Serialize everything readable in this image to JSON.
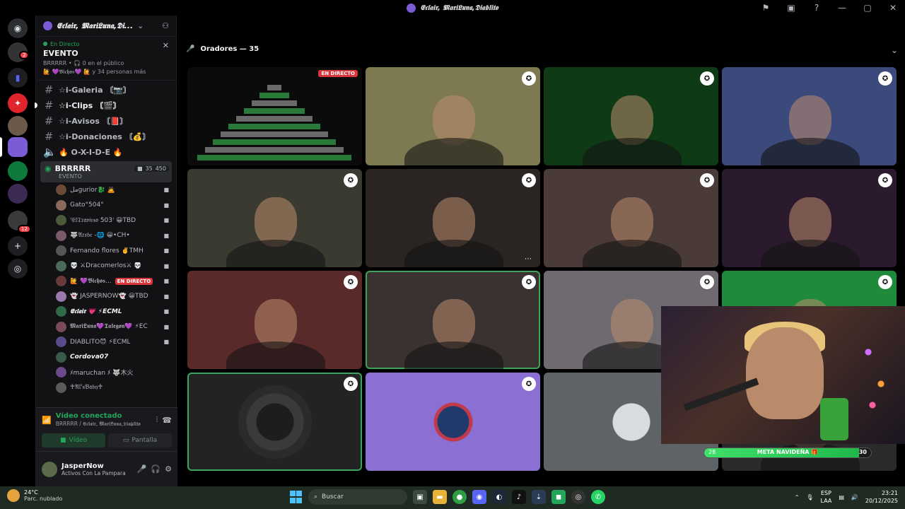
{
  "window": {
    "title": "𝕰𝖈𝖑𝖆𝖎𝖗, 𝕸𝖆𝖗𝖎𝕷𝖚𝖓𝖆,𝕯𝖎𝖆𝖇𝖑𝖎𝖙𝖔"
  },
  "rail": {
    "dm_badge": "2",
    "folder_badge": "12"
  },
  "guild": {
    "name": "𝕰𝖈𝖑𝖆𝖎𝖗, 𝕸𝖆𝖗𝖎𝕷𝖚𝖓𝖆,𝕯𝖎...",
    "event_live": "En Directo",
    "event_title": "EVENTO",
    "event_meta": "BRRRRR • 🎧 0 en el público",
    "event_members": "🙋 💜𝕭𝖎𝖈𝖍𝖔𝖘💜 🙋 y 34 personas más"
  },
  "channels": [
    {
      "name": "☆i-Galeria 〘📷〙"
    },
    {
      "name": "☆i-Clips 〘🎬〙"
    },
    {
      "name": "☆i-Avisos 〘📕〙"
    },
    {
      "name": "☆i-Donaciones 〘💰〙"
    },
    {
      "name": "🔥 O-X-I-D-E 🔥"
    }
  ],
  "voice_channel": {
    "name": "BRRRRR",
    "video_count": "35",
    "user_count": "450",
    "subtitle": "EVENTO"
  },
  "participants": [
    {
      "name": "ملgurior🐉 🙇",
      "tag": ""
    },
    {
      "name": "Gato°504°",
      "tag": ""
    },
    {
      "name": "ꜝ𝔈𝔩𝔗𝔯𝔞𝔳𝔦𝔢𝔰𝔬 503ꜝ 😀TBD",
      "tag": ""
    },
    {
      "name": "🐺𝔄𝔯𝔵𝔟𝔢 -🌐 😀•CH•",
      "tag": ""
    },
    {
      "name": "Fernando flores ✌️TMH",
      "tag": ""
    },
    {
      "name": "💀 ⚔Dracomerlos⚔ 💀",
      "tag": ""
    },
    {
      "name": "🙋 💜𝕭𝖎𝖈𝖍𝖔𝖘...",
      "tag": "EN DIRECTO"
    },
    {
      "name": "👻 JASPERNOW👻 😀TBD",
      "tag": ""
    },
    {
      "name": "𝕰𝖈𝖑𝖆𝖎𝖗 💗 ⚡ECML",
      "tag": ""
    },
    {
      "name": "𝕸𝖆𝖗𝖎𝕷𝖚𝖓𝖆💜𝕿𝖆𝖑𝖊𝖌𝖔𝖓💜 ⚡EC",
      "tag": ""
    },
    {
      "name": "DIABLITO😈 ⚡ECML",
      "tag": ""
    },
    {
      "name": "Cordova07",
      "tag": ""
    },
    {
      "name": "ﾒmaruchan ﾒ 🐺木火",
      "tag": ""
    },
    {
      "name": "♰𝔄𝔩'𝔰𝔅𝔞𝔟𝔶♰",
      "tag": ""
    }
  ],
  "voice_panel": {
    "title": "Vídeo conectado",
    "subtitle": "BRRRRR / 𝕰𝖈𝖑𝖆𝖎𝖗, 𝕸𝖆𝖗𝖎𝕷𝖚𝖓𝖆,𝕯𝖎𝖆𝖇𝖑𝖎𝖙𝖔",
    "video_label": "Vídeo",
    "screen_label": "Pantalla"
  },
  "user": {
    "name": "JasperNow",
    "status": "Activos Con La Pampara"
  },
  "stage": {
    "speakers_label": "Oradores — 35",
    "live_badge": "EN DIRECTO",
    "goal_label": "META NAVIDEÑA 🎁",
    "goal_current": "28",
    "goal_target": "30",
    "goal_fraction": 0.93
  },
  "tiles": [
    {
      "bg": "#0b0b0b",
      "kind": "screen"
    },
    {
      "bg": "#7d7a52",
      "kind": "cam"
    },
    {
      "bg": "#0e3b16",
      "kind": "cam"
    },
    {
      "bg": "#3b4a7a",
      "kind": "cam"
    },
    {
      "bg": "#3a3a30",
      "kind": "cam"
    },
    {
      "bg": "#2a2522",
      "kind": "cam"
    },
    {
      "bg": "#4a3a38",
      "kind": "cam"
    },
    {
      "bg": "#2b1a2e",
      "kind": "cam"
    },
    {
      "bg": "#5a2a2a",
      "kind": "cam"
    },
    {
      "bg": "#3a3230",
      "kind": "cam"
    },
    {
      "bg": "#6e6a70",
      "kind": "cam"
    },
    {
      "bg": "#1e8a3a",
      "kind": "cam"
    },
    {
      "bg": "#232323",
      "kind": "avatar"
    },
    {
      "bg": "#8b6fd3",
      "kind": "avatar"
    },
    {
      "bg": "#5d6366",
      "kind": "avatar"
    },
    {
      "bg": "#2a2a2a",
      "kind": "cam"
    }
  ],
  "taskbar": {
    "temp": "24°C",
    "weather": "Parc. nublado",
    "search_placeholder": "Buscar",
    "lang1": "ESP",
    "lang2": "LAA",
    "time": "23:21",
    "date": "20/12/2025"
  },
  "colors": {
    "accent_green": "#23a55a",
    "live_red": "#da373c",
    "speaking_outline": "#3ba55c"
  }
}
